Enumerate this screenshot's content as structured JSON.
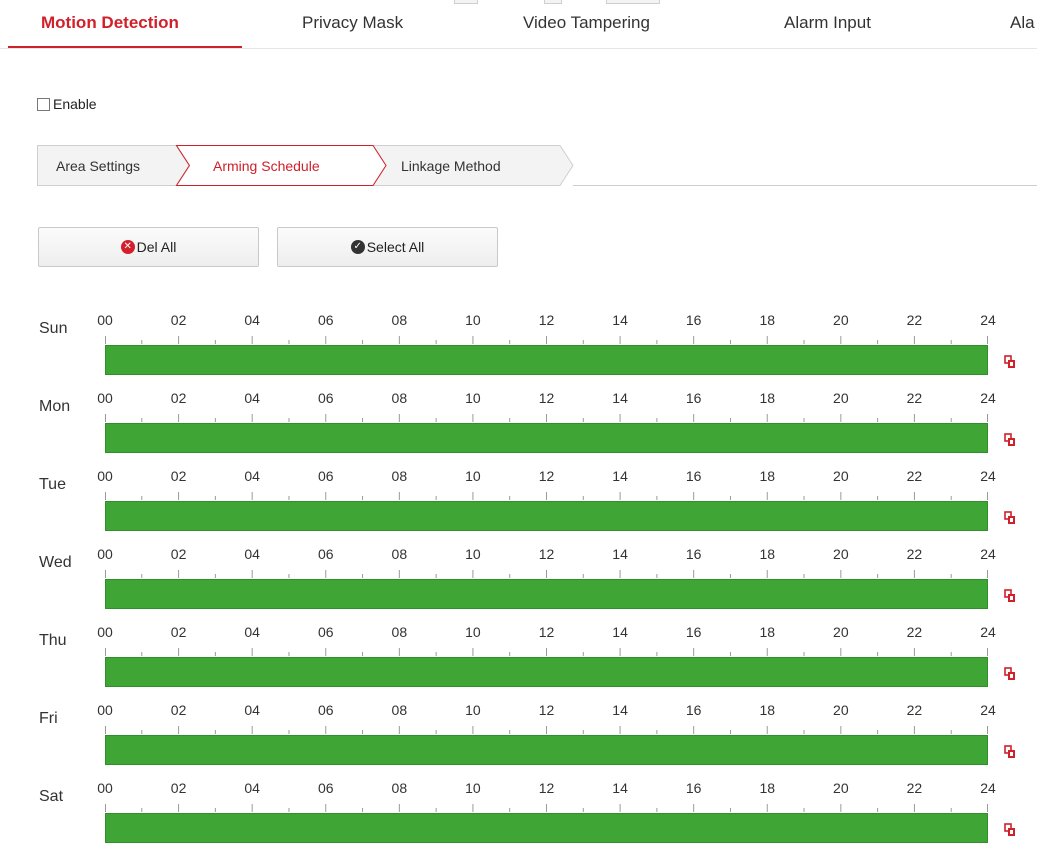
{
  "tabs": [
    {
      "label": "Motion Detection",
      "active": true
    },
    {
      "label": "Privacy Mask",
      "active": false
    },
    {
      "label": "Video Tampering",
      "active": false
    },
    {
      "label": "Alarm Input",
      "active": false
    },
    {
      "label": "Ala",
      "active": false
    }
  ],
  "enable": {
    "label": "Enable",
    "checked": false
  },
  "subtabs": [
    {
      "label": "Area Settings",
      "active": false
    },
    {
      "label": "Arming Schedule",
      "active": true
    },
    {
      "label": "Linkage Method",
      "active": false
    }
  ],
  "buttons": {
    "del_all": {
      "label": "Del All",
      "icon": "times-circle-icon"
    },
    "select_all": {
      "label": "Select All",
      "icon": "check-circle-icon"
    }
  },
  "hours": [
    "00",
    "02",
    "04",
    "06",
    "08",
    "10",
    "12",
    "14",
    "16",
    "18",
    "20",
    "22",
    "24"
  ],
  "days": [
    {
      "label": "Sun",
      "armed_from": 0,
      "armed_to": 24
    },
    {
      "label": "Mon",
      "armed_from": 0,
      "armed_to": 24
    },
    {
      "label": "Tue",
      "armed_from": 0,
      "armed_to": 24
    },
    {
      "label": "Wed",
      "armed_from": 0,
      "armed_to": 24
    },
    {
      "label": "Thu",
      "armed_from": 0,
      "armed_to": 24
    },
    {
      "label": "Fri",
      "armed_from": 0,
      "armed_to": 24
    },
    {
      "label": "Sat",
      "armed_from": 0,
      "armed_to": 24
    }
  ],
  "colors": {
    "accent": "#d0202a",
    "armed": "#3fa535",
    "copy_icon": "#d0202a"
  },
  "icons": {
    "copy": "copy-icon"
  }
}
